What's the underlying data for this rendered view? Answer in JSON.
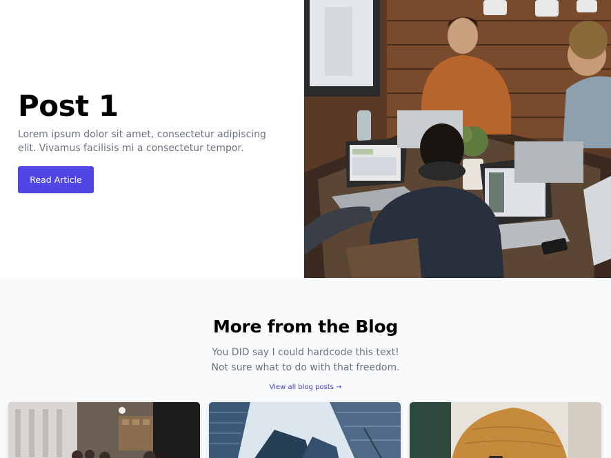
{
  "hero": {
    "title": "Post 1",
    "description": "Lorem ipsum dolor sit amet, consectetur adipiscing elit. Vivamus facilisis mi a consectetur tempor.",
    "button_label": "Read Article",
    "image": "people-working-on-laptops-photo"
  },
  "blog": {
    "title": "More from the Blog",
    "subtitle_line1": "You DID say I could hardcode this text!",
    "subtitle_line2": "Not sure what to do with that freedom.",
    "link_label": "View all blog posts →",
    "cards": [
      {
        "image": "cafe-interior-photo"
      },
      {
        "image": "skyscrapers-photo"
      },
      {
        "image": "person-in-yellow-sweater-photo"
      }
    ]
  },
  "colors": {
    "accent": "#4f46e5",
    "link": "#4338ca",
    "section_bg": "#f8fafc",
    "muted_text": "#6b7280"
  }
}
